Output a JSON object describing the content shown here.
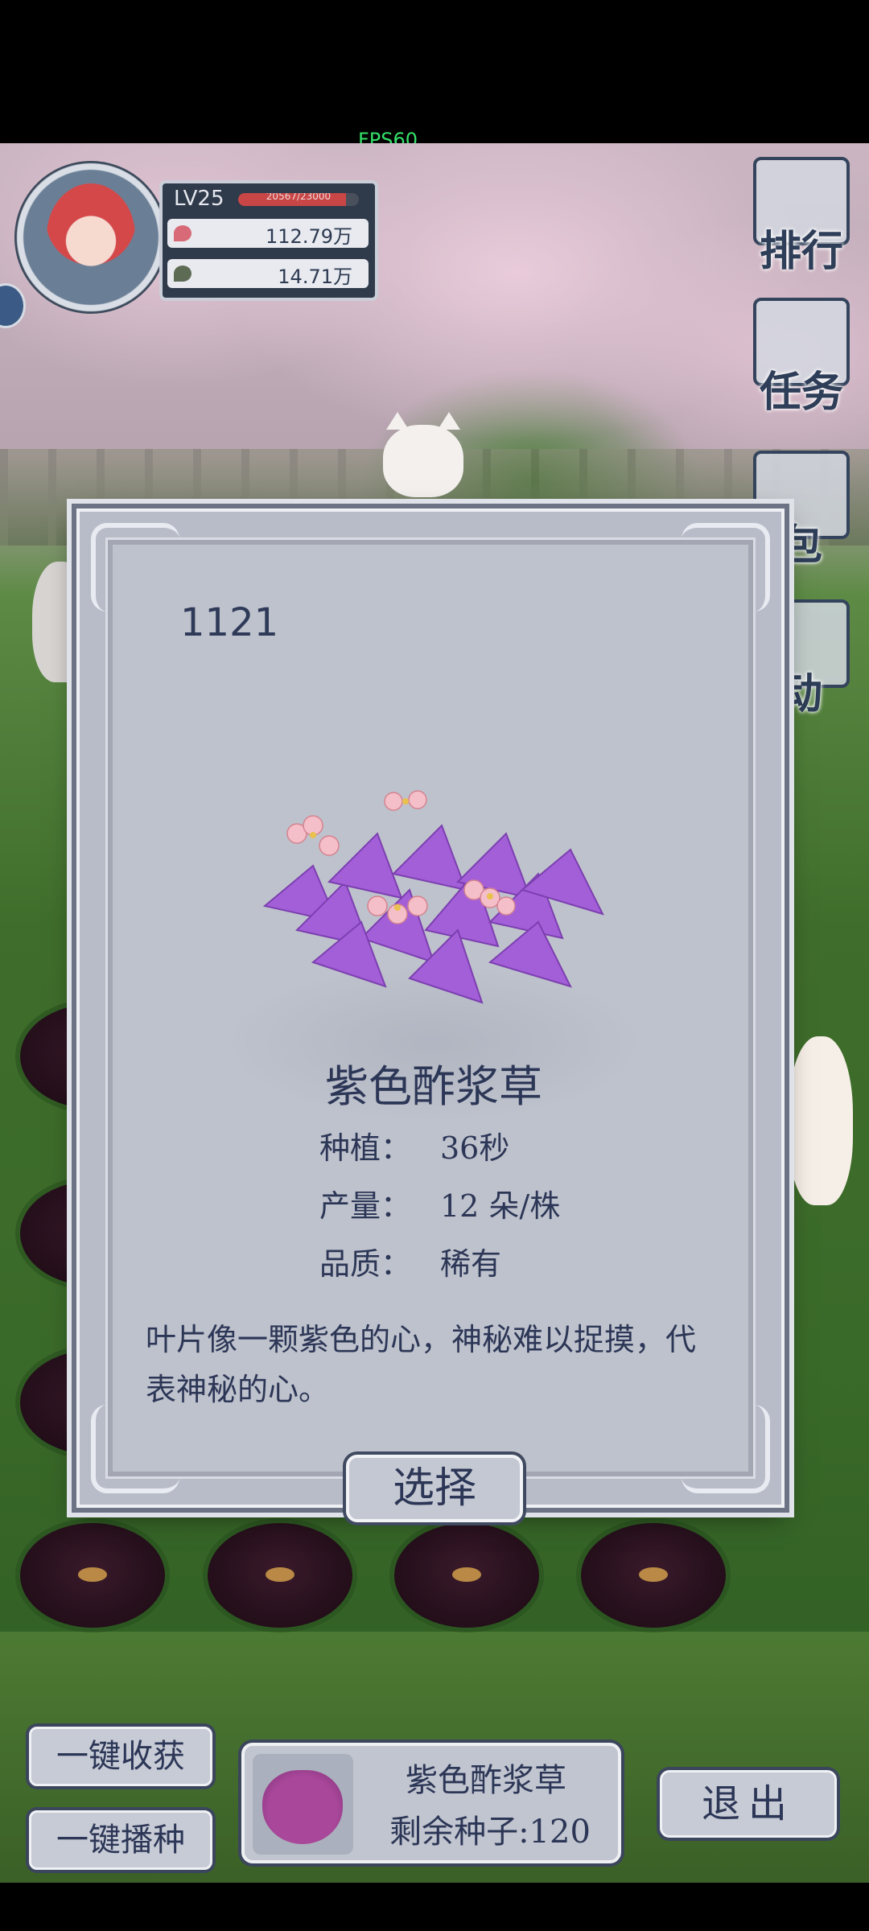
{
  "hud": {
    "fps": "FPS60"
  },
  "player": {
    "level": "LV25",
    "exp_text": "20567/23000",
    "exp_fraction": 0.89,
    "currency_1": "112.79万",
    "currency_2": "14.71万"
  },
  "side_menu": [
    {
      "label": "排行",
      "icon": "ranking-icon"
    },
    {
      "label": "任务",
      "icon": "task-clipboard-icon"
    },
    {
      "label": "包",
      "icon": "bag-icon"
    },
    {
      "label": "动",
      "icon": "activity-icon"
    }
  ],
  "modal": {
    "id": "1121",
    "plant_name": "紫色酢浆草",
    "stats": [
      {
        "key": "种植：",
        "value": "36秒"
      },
      {
        "key": "产量：",
        "value": "12 朵/株"
      },
      {
        "key": "品质：",
        "value": "稀有"
      }
    ],
    "description": "叶片像一颗紫色的心，神秘难以捉摸，代表神秘的心。",
    "select_label": "选择"
  },
  "bottom": {
    "harvest_all": "一键收获",
    "sow_all": "一键播种",
    "seed_name": "紫色酢浆草",
    "seed_remaining": "剩余种子:120",
    "exit_label": "退出"
  },
  "colors": {
    "accent_text": "#2c3656",
    "panel": "#bec2cc",
    "flower_purple": "#a35fd8",
    "petal_pink": "#f4bfc9"
  }
}
